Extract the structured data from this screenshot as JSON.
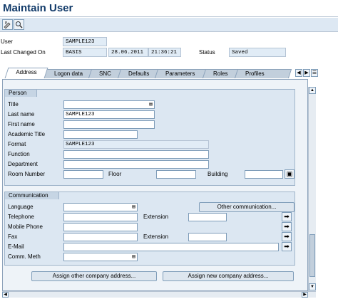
{
  "window": {
    "title": "Maintain User"
  },
  "toolbar": {
    "icons": [
      "display-change-icon",
      "find-icon"
    ]
  },
  "header": {
    "user_label": "User",
    "user_value": "SAMPLE123",
    "last_changed_label": "Last Changed On",
    "last_changed_by": "BASIS",
    "last_changed_date": "28.06.2011",
    "last_changed_time": "21:36:21",
    "status_label": "Status",
    "status_value": "Saved"
  },
  "tabs": [
    {
      "label": "Address"
    },
    {
      "label": "Logon data"
    },
    {
      "label": "SNC"
    },
    {
      "label": "Defaults"
    },
    {
      "label": "Parameters"
    },
    {
      "label": "Roles"
    },
    {
      "label": "Profiles"
    }
  ],
  "person": {
    "group_title": "Person",
    "title_label": "Title",
    "title_value": "",
    "last_name_label": "Last name",
    "last_name_value": "SAMPLE123",
    "first_name_label": "First name",
    "first_name_value": "",
    "academic_title_label": "Academic Title",
    "academic_title_value": "",
    "format_label": "Format",
    "format_value": "SAMPLE123",
    "function_label": "Function",
    "function_value": "",
    "department_label": "Department",
    "department_value": "",
    "room_number_label": "Room Number",
    "room_number_value": "",
    "floor_label": "Floor",
    "floor_value": "",
    "building_label": "Building",
    "building_value": ""
  },
  "communication": {
    "group_title": "Communication",
    "language_label": "Language",
    "language_value": "",
    "other_comm_button": "Other communication...",
    "telephone_label": "Telephone",
    "telephone_value": "",
    "extension_label": "Extension",
    "extension_value": "",
    "mobile_label": "Mobile Phone",
    "mobile_value": "",
    "fax_label": "Fax",
    "fax_value": "",
    "fax_extension_label": "Extension",
    "fax_extension_value": "",
    "email_label": "E-Mail",
    "email_value": "",
    "comm_meth_label": "Comm. Meth",
    "comm_meth_value": ""
  },
  "actions": {
    "assign_other_label": "Assign other company address...",
    "assign_new_label": "Assign new company address..."
  }
}
